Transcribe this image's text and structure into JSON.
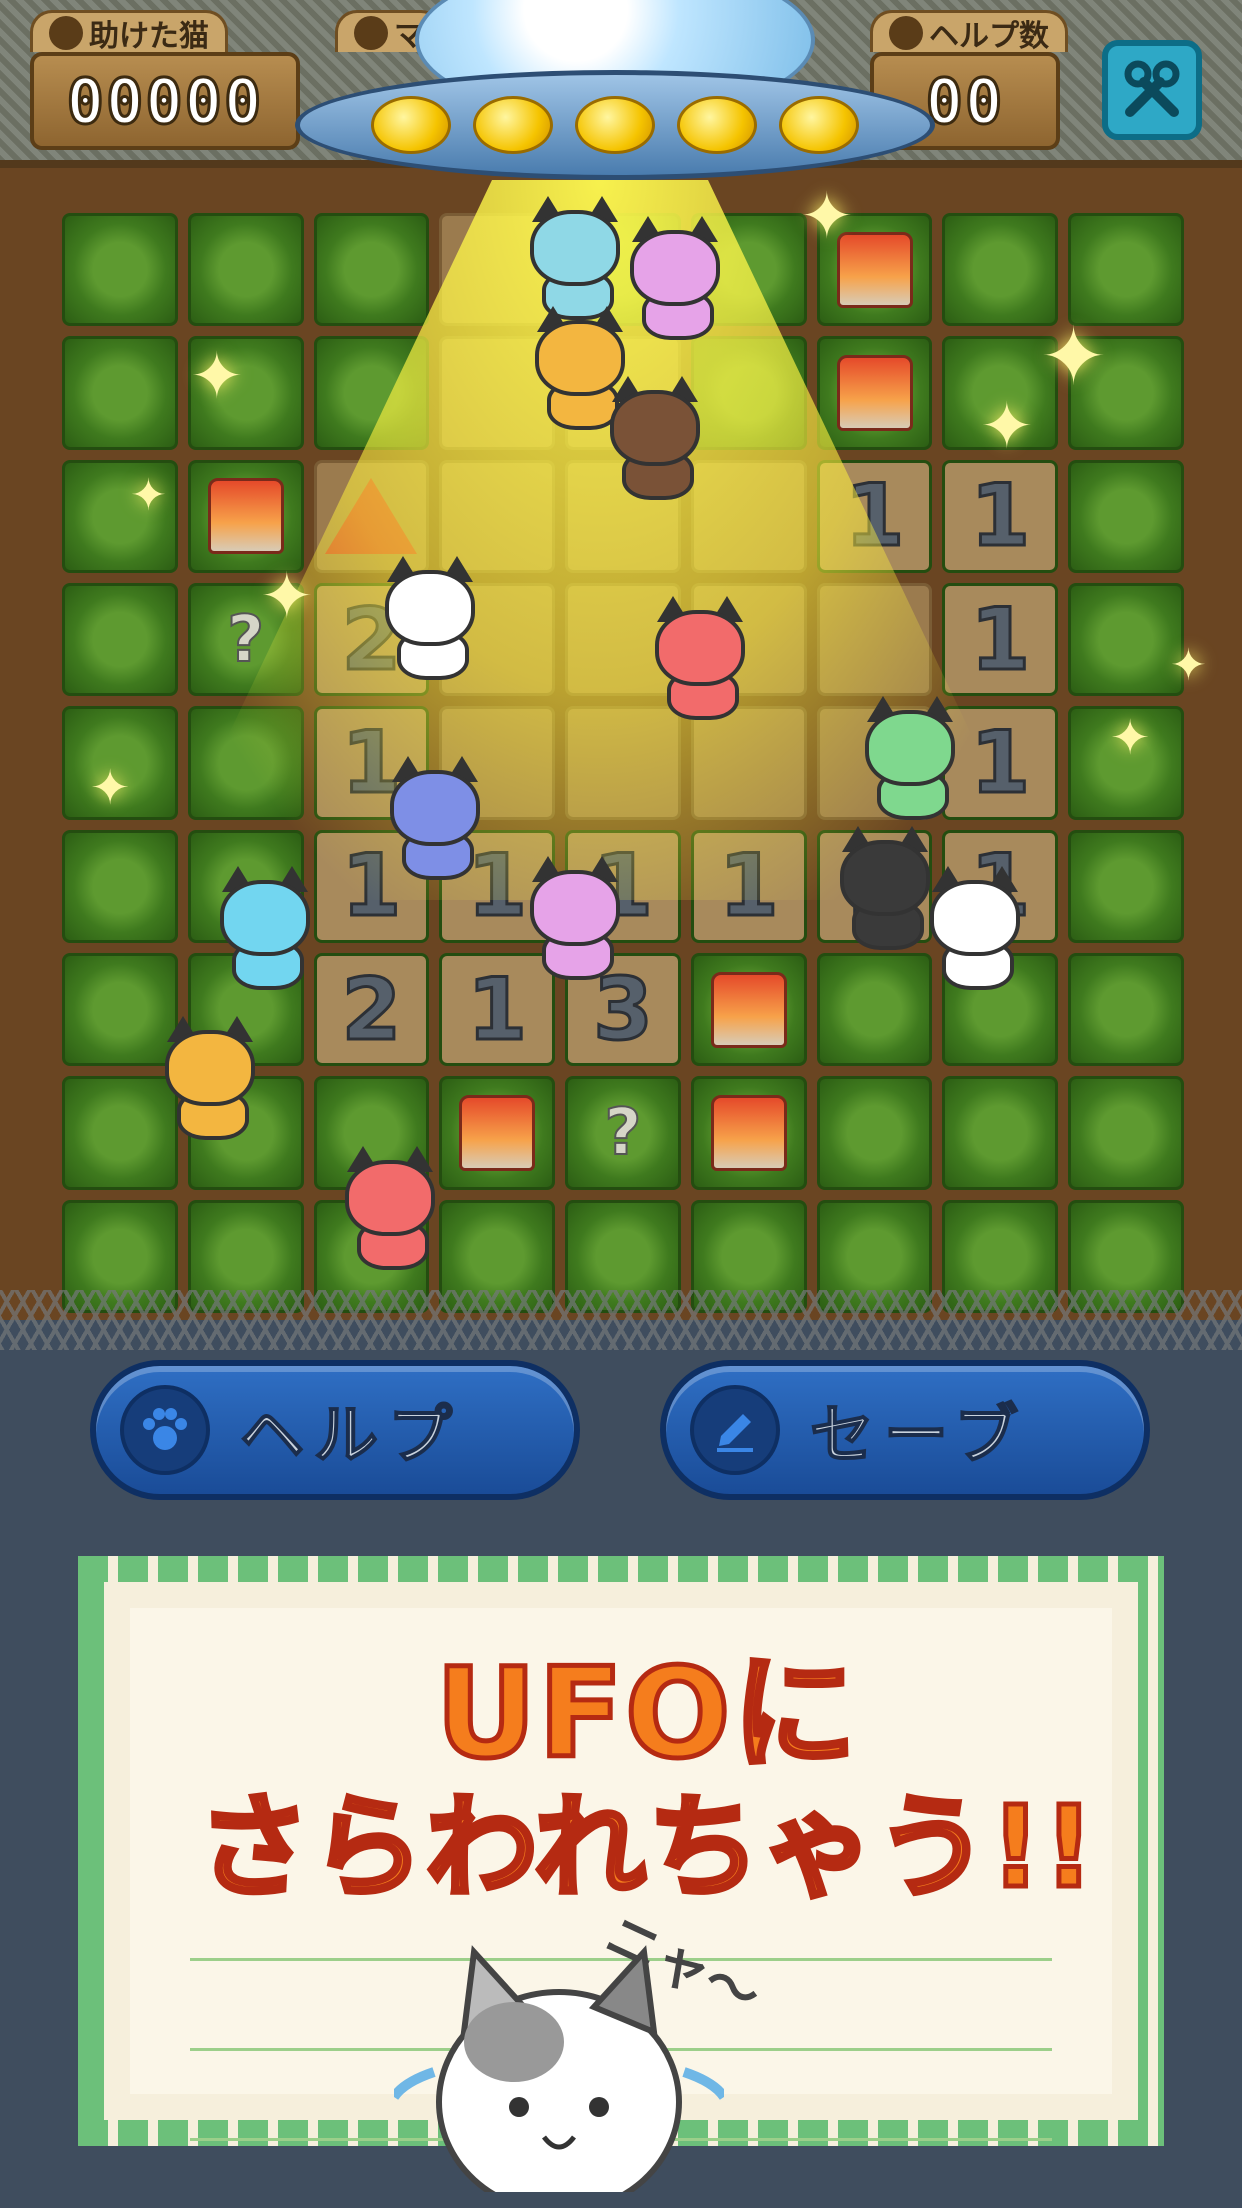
{
  "hud": {
    "rescued_label": "助けた猫",
    "rescued_value": "00000",
    "move_label": "マ",
    "help_count_label": "ヘルプ数",
    "help_count_value": "00"
  },
  "board": {
    "rows": [
      [
        "grass",
        "grass",
        "grass",
        "open",
        "grass",
        "grass",
        "pin",
        "grass",
        "grass"
      ],
      [
        "grass",
        "grass",
        "grass",
        "open",
        "open",
        "grass",
        "pin",
        "grass",
        "grass"
      ],
      [
        "grass",
        "pin",
        "warn",
        "open",
        "open",
        "open",
        "1",
        "1",
        "grass"
      ],
      [
        "grass",
        "?",
        "2",
        "open",
        "open",
        "open",
        "open",
        "1",
        "grass"
      ],
      [
        "grass",
        "grass",
        "1",
        "open",
        "open",
        "open",
        "open",
        "1",
        "grass"
      ],
      [
        "grass",
        "grass",
        "1",
        "1",
        "1",
        "1",
        "1",
        "1",
        "grass"
      ],
      [
        "grass",
        "grass",
        "2",
        "1",
        "3",
        "pin",
        "grass",
        "grass",
        "grass"
      ],
      [
        "grass",
        "grass",
        "grass",
        "pin",
        "?",
        "pin",
        "grass",
        "grass",
        "grass"
      ],
      [
        "grass",
        "grass",
        "grass",
        "grass",
        "grass",
        "grass",
        "grass",
        "grass",
        "grass"
      ]
    ]
  },
  "buttons": {
    "help_label": "ヘルプ",
    "save_label": "セーブ"
  },
  "note": {
    "line1": "UFOに",
    "line2": "さらわれちゃう!!",
    "cat_sound": "ニャ〜"
  },
  "colors": {
    "button_blue": "#2f6fc4",
    "headline_orange": "#f57d1d",
    "beam_yellow": "#fff250"
  }
}
